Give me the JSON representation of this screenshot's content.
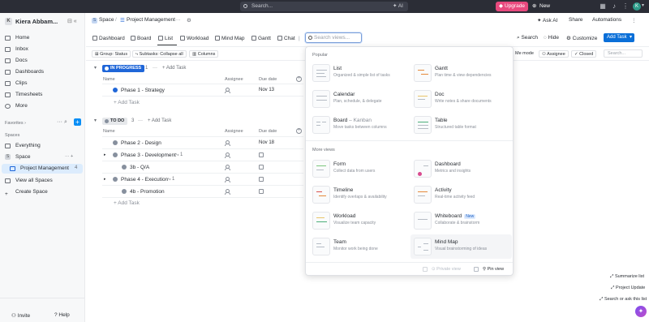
{
  "topbar": {
    "search_label": "Search...",
    "ai_label": "AI",
    "upgrade_label": "Upgrade",
    "new_label": "New",
    "avatar_initial": "K"
  },
  "sidebar": {
    "workspace_name": "Kiera Abbam...",
    "workspace_initial": "K",
    "nav": [
      {
        "label": "Home"
      },
      {
        "label": "Inbox"
      },
      {
        "label": "Docs"
      },
      {
        "label": "Dashboards"
      },
      {
        "label": "Clips"
      },
      {
        "label": "Timesheets"
      },
      {
        "label": "More"
      }
    ],
    "favorites_label": "Favorites",
    "spaces_label": "Spaces",
    "everything_label": "Everything",
    "space_label": "Space",
    "space_initial": "S",
    "project_label": "Project Management",
    "project_count": "4",
    "view_all_spaces": "View all Spaces",
    "create_space": "Create Space",
    "invite_label": "Invite",
    "help_label": "Help"
  },
  "header": {
    "breadcrumb_space": "Space",
    "breadcrumb_sep": "/",
    "breadcrumb_project": "Project Management",
    "more_dots": "···",
    "ask_ai": "Ask AI",
    "share": "Share",
    "automations": "Automations"
  },
  "views": {
    "tabs": [
      {
        "label": "Dashboard"
      },
      {
        "label": "Board"
      },
      {
        "label": "List"
      },
      {
        "label": "Workload"
      },
      {
        "label": "Mind Map"
      },
      {
        "label": "Gantt"
      },
      {
        "label": "Chat"
      }
    ],
    "search_placeholder": "Search views...",
    "search": "Search",
    "hide": "Hide",
    "customize": "Customize",
    "add_task": "Add Task"
  },
  "filters": {
    "group": "Group: Status",
    "subtasks": "Subtasks: Collapse all",
    "columns": "Columns",
    "me_mode": "Me mode",
    "assignee": "Assignee",
    "closed": "Closed",
    "search_placeholder": "Search..."
  },
  "groups": [
    {
      "status": "IN PROGRESS",
      "status_color": "#1f66d8",
      "count": "1",
      "add_task": "Add Task",
      "columns": {
        "name": "Name",
        "assignee": "Assignee",
        "due": "Due date"
      },
      "tasks": [
        {
          "name": "Phase 1 - Strategy",
          "due": "Nov 13",
          "dot": "#1f66d8"
        }
      ],
      "add_row": "Add Task"
    },
    {
      "status": "TO DO",
      "status_color": "#87909e",
      "count": "3",
      "add_task": "Add Task",
      "columns": {
        "name": "Name",
        "assignee": "Assignee",
        "due": "Due date"
      },
      "tasks": [
        {
          "name": "Phase 2 - Design",
          "due": "Nov 18",
          "dot": "#87909e"
        },
        {
          "name": "Phase 3 - Development",
          "subtasks": "1",
          "dot": "#87909e"
        },
        {
          "name": "3b - Q/A",
          "dot": "#87909e"
        },
        {
          "name": "Phase 4 - Execution",
          "subtasks": "1",
          "dot": "#87909e"
        },
        {
          "name": "4b - Promotion",
          "dot": "#87909e"
        }
      ],
      "add_row": "Add Task"
    }
  ],
  "dropdown": {
    "popular_label": "Popular",
    "more_label": "More views",
    "popular": [
      {
        "title": "List",
        "desc": "Organized & simple list of tasks"
      },
      {
        "title": "Gantt",
        "desc": "Plan time & view dependencies"
      },
      {
        "title": "Calendar",
        "desc": "Plan, schedule, & delegate"
      },
      {
        "title": "Doc",
        "desc": "Write notes & share documents"
      },
      {
        "title": "Board",
        "title_suffix": "– Kanban",
        "desc": "Move tasks between columns"
      },
      {
        "title": "Table",
        "desc": "Structured table format"
      }
    ],
    "more": [
      {
        "title": "Form",
        "desc": "Collect data from users"
      },
      {
        "title": "Dashboard",
        "desc": "Metrics and insights"
      },
      {
        "title": "Timeline",
        "desc": "Identify overlaps & availability"
      },
      {
        "title": "Activity",
        "desc": "Real-time activity feed"
      },
      {
        "title": "Workload",
        "desc": "Visualize team capacity"
      },
      {
        "title": "Whiteboard",
        "badge": "New",
        "desc": "Collaborate & brainstorm"
      },
      {
        "title": "Team",
        "desc": "Monitor work being done"
      },
      {
        "title": "Mind Map",
        "desc": "Visual brainstorming of ideas"
      }
    ],
    "private_view": "Private view",
    "pin_view": "Pin view"
  },
  "right_links": {
    "summarize": "Summarize list",
    "project_update": "Project Update",
    "search_or_ask": "Search or ask this list"
  }
}
